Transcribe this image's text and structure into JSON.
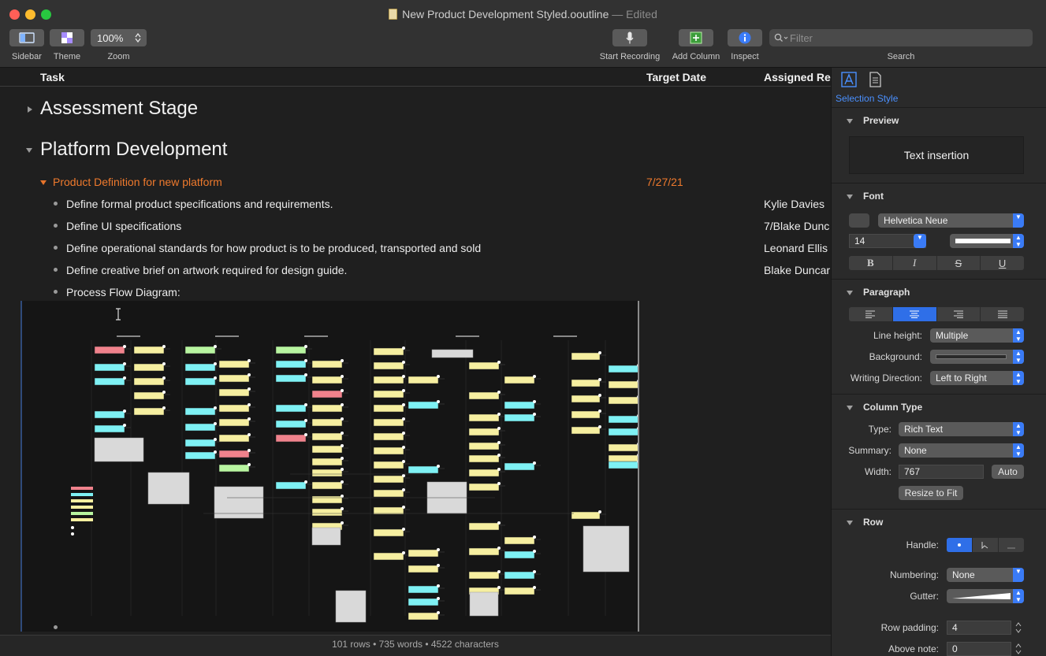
{
  "window": {
    "title": "New Product Development Styled.ooutline",
    "edited_suffix": "— Edited"
  },
  "toolbar": {
    "sidebar_label": "Sidebar",
    "theme_label": "Theme",
    "zoom_value": "100%",
    "zoom_label": "Zoom",
    "record_label": "Start Recording",
    "add_column_label": "Add Column",
    "inspect_label": "Inspect",
    "search_placeholder": "Filter",
    "search_label": "Search"
  },
  "outline": {
    "columns": {
      "task": "Task",
      "target_date": "Target Date",
      "assigned": "Assigned Re"
    },
    "sections": [
      {
        "title": "Assessment Stage"
      },
      {
        "title": "Platform Development"
      }
    ],
    "group": {
      "title": "Product Definition for new platform",
      "date": "7/27/21"
    },
    "items": [
      {
        "task": "Define formal product specifications and requirements.",
        "assigned": "Kylie Davies"
      },
      {
        "task": "Define UI specifications",
        "assigned": "7/Blake Dunc"
      },
      {
        "task": "Define operational standards for how product is to be produced, transported and sold",
        "assigned": "Leonard Ellis"
      },
      {
        "task": "Define creative brief on artwork required for design guide.",
        "assigned": "Blake Duncar"
      },
      {
        "task": "Process Flow Diagram:",
        "assigned": ""
      }
    ]
  },
  "status": {
    "text": "101 rows • 735 words • 4522 characters"
  },
  "inspector": {
    "title": "Selection Style",
    "preview": {
      "header": "Preview",
      "text": "Text insertion"
    },
    "font": {
      "header": "Font",
      "family": "Helvetica Neue",
      "size": "14",
      "bold": "B",
      "italic": "I",
      "strike": "S",
      "underline": "U"
    },
    "paragraph": {
      "header": "Paragraph",
      "line_height_label": "Line height:",
      "line_height_value": "Multiple",
      "background_label": "Background:",
      "direction_label": "Writing Direction:",
      "direction_value": "Left to Right"
    },
    "column_type": {
      "header": "Column Type",
      "type_label": "Type:",
      "type_value": "Rich Text",
      "summary_label": "Summary:",
      "summary_value": "None",
      "width_label": "Width:",
      "width_value": "767",
      "auto_label": "Auto",
      "resize_label": "Resize to Fit"
    },
    "row": {
      "header": "Row",
      "handle_label": "Handle:",
      "numbering_label": "Numbering:",
      "numbering_value": "None",
      "gutter_label": "Gutter:",
      "padding_label": "Row padding:",
      "padding_value": "4",
      "above_note_label": "Above note:",
      "above_note_value": "0"
    }
  },
  "colors": {
    "accent": "#2f6fe8",
    "group_orange": "#ef7a2d"
  }
}
